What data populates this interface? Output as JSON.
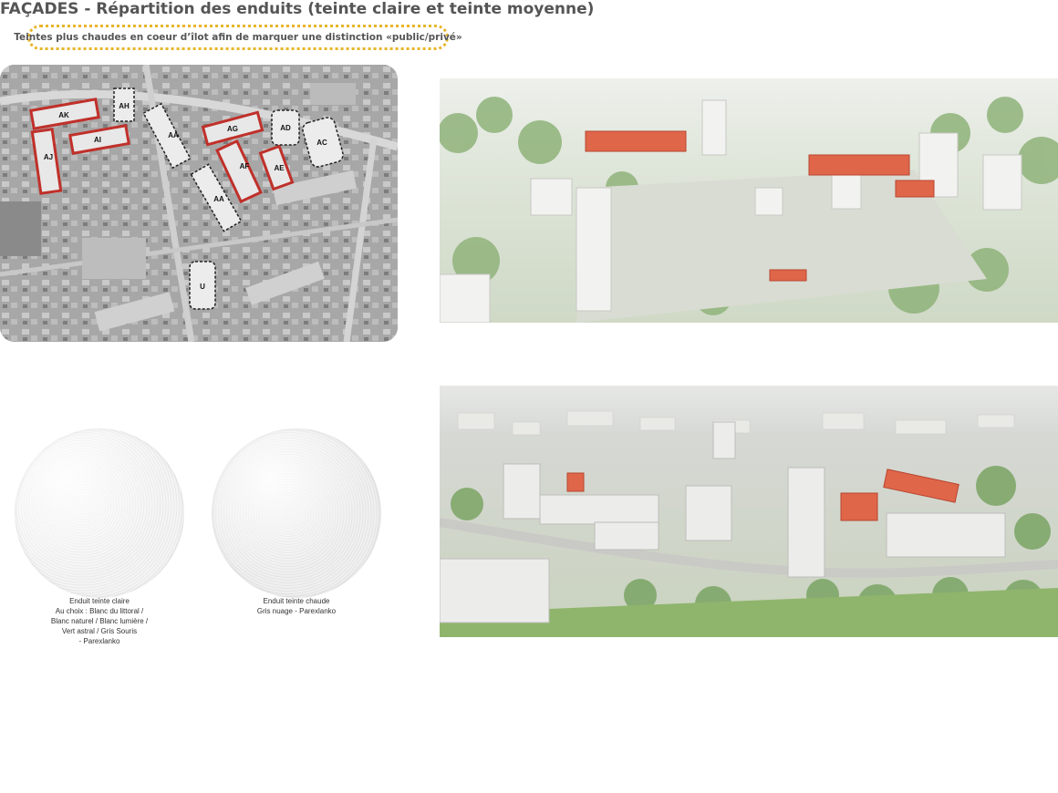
{
  "header": {
    "title": "FAÇADES - Répartition des enduits (teinte claire et teinte moyenne)",
    "note": "Teintes plus chaudes en coeur d’îlot afin de marquer une distinction «public/privé»"
  },
  "plan": {
    "buildings_highlighted": [
      "AK",
      "AJ",
      "AI",
      "AG",
      "AF",
      "AE"
    ],
    "buildings_other": [
      "AH",
      "AA",
      "AD",
      "AC",
      "AA",
      "U"
    ]
  },
  "swatches": {
    "light": {
      "lines": [
        "Enduit teinte claire",
        "Au choix : Blanc du littoral /",
        "Blanc naturel / Blanc lumière /",
        "Vert astral / Gris Souris",
        "- Parexlanko"
      ]
    },
    "warm": {
      "lines": [
        "Enduit teinte chaude",
        "Gris nuage - Parexlanko"
      ]
    }
  },
  "colors": {
    "highlight": "#c0302a",
    "note_border": "#e8b52a",
    "accent_facade": "#e0664a"
  }
}
